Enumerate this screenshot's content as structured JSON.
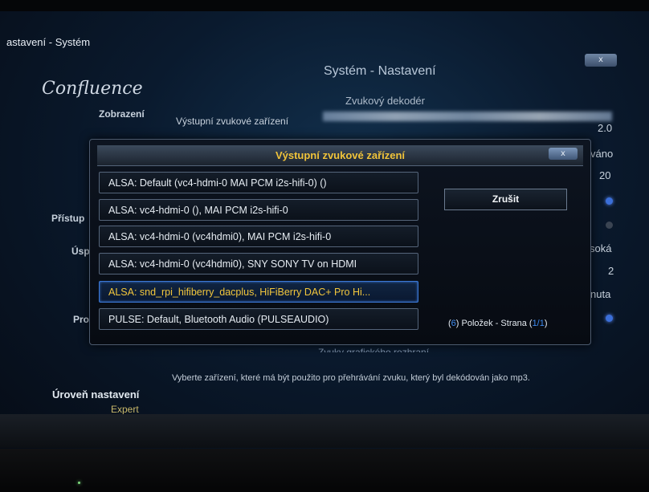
{
  "window": {
    "title": "astavení - Systém",
    "close_label": "x"
  },
  "header": {
    "logo": "Confluence",
    "title": "Systém - Nastavení",
    "subtitle": "Zvukový dekodér"
  },
  "left_menu": {
    "display": "Zobrazení",
    "access": "Přístup",
    "energy": "Úsp",
    "profiles": "Pro"
  },
  "setting": {
    "name": "Výstupní zvukové zařízení"
  },
  "right_values": [
    "2.0",
    "váno",
    "20",
    "soká",
    "2",
    "nuta"
  ],
  "dialog": {
    "title": "Výstupní zvukové zařízení",
    "close_label": "x",
    "options": [
      "ALSA: Default (vc4-hdmi-0 MAI PCM i2s-hifi-0) ()",
      "ALSA: vc4-hdmi-0 (), MAI PCM i2s-hifi-0",
      "ALSA: vc4-hdmi-0 (vc4hdmi0), MAI PCM i2s-hifi-0",
      "ALSA: vc4-hdmi-0 (vc4hdmi0), SNY SONY TV on HDMI",
      "ALSA: snd_rpi_hifiberry_dacplus, HiFiBerry DAC+ Pro Hi...",
      "PULSE: Default, Bluetooth Audio (PULSEAUDIO)"
    ],
    "selected_index": 4,
    "cancel_label": "Zrušit",
    "count": {
      "open": "(",
      "items": "6",
      "items_label": ") Položek - Strana (",
      "page": "1/1",
      "close": ")"
    }
  },
  "obscured_label": "Zvuky grafického rozhraní",
  "footer": {
    "description": "Vyberte zařízení, které má být použito pro přehrávání zvuku, který byl dekódován jako mp3.",
    "level_label": "Úroveň nastavení",
    "level_value": "Expert"
  },
  "colors": {
    "accent_yellow": "#f2c63c",
    "accent_blue": "#3b78d6",
    "count_number": "#3f8cf0"
  }
}
